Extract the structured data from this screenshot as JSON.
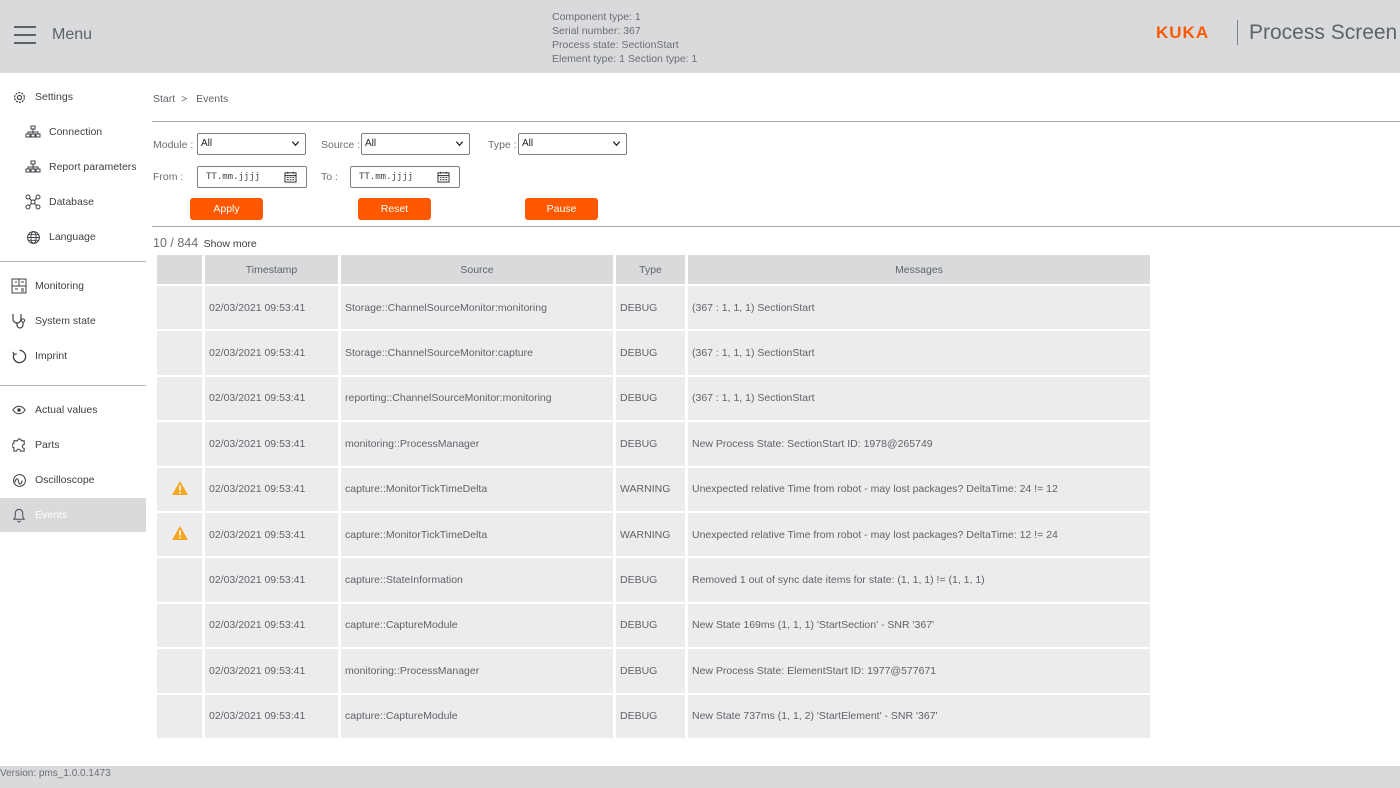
{
  "header": {
    "menu_label": "Menu",
    "info": {
      "component_type": "Component type: 1",
      "serial_number": "Serial number: 367",
      "process_state": "Process state: SectionStart",
      "element_type": "Element type: 1 Section type: 1"
    },
    "brand": "KUKA",
    "app_title": "Process Screen",
    "brand_color": "#ff5800"
  },
  "sidebar": {
    "settings": "Settings",
    "connection": "Connection",
    "report_parameters": "Report parameters",
    "database": "Database",
    "language": "Language",
    "monitoring": "Monitoring",
    "system_state": "System state",
    "imprint": "Imprint",
    "actual_values": "Actual values",
    "parts": "Parts",
    "oscilloscope": "Oscilloscope",
    "events": "Events",
    "active_item": "Events"
  },
  "breadcrumb": {
    "root": "Start",
    "separator": ">",
    "current": "Events"
  },
  "filters": {
    "module_label": "Module :",
    "module_value": "All",
    "source_label": "Source :",
    "source_value": "All",
    "type_label": "Type :",
    "type_value": "All",
    "from_label": "From :",
    "from_placeholder": "TT.mm.jjjj",
    "to_label": "To :",
    "to_placeholder": "TT.mm.jjjj"
  },
  "buttons": {
    "apply": "Apply",
    "reset": "Reset",
    "pause": "Pause"
  },
  "results": {
    "count": "10 / 844",
    "show_more": "Show more"
  },
  "table": {
    "columns": [
      "",
      "Timestamp",
      "Source",
      "Type",
      "Messages"
    ],
    "rows": [
      {
        "icon": "",
        "timestamp": "02/03/2021 09:53:41",
        "source": "Storage::ChannelSourceMonitor:monitoring",
        "type": "DEBUG",
        "message": "(367 : 1, 1, 1) SectionStart"
      },
      {
        "icon": "",
        "timestamp": "02/03/2021 09:53:41",
        "source": "Storage::ChannelSourceMonitor:capture",
        "type": "DEBUG",
        "message": "(367 : 1, 1, 1) SectionStart"
      },
      {
        "icon": "",
        "timestamp": "02/03/2021 09:53:41",
        "source": "reporting::ChannelSourceMonitor:monitoring",
        "type": "DEBUG",
        "message": "(367 : 1, 1, 1) SectionStart"
      },
      {
        "icon": "",
        "timestamp": "02/03/2021 09:53:41",
        "source": "monitoring::ProcessManager",
        "type": "DEBUG",
        "message": "New Process State: SectionStart ID: 1978@265749"
      },
      {
        "icon": "warning-icon",
        "timestamp": "02/03/2021 09:53:41",
        "source": "capture::MonitorTickTimeDelta",
        "type": "WARNING",
        "message": "Unexpected relative Time from robot - may lost packages? DeltaTime: 24 != 12"
      },
      {
        "icon": "warning-icon",
        "timestamp": "02/03/2021 09:53:41",
        "source": "capture::MonitorTickTimeDelta",
        "type": "WARNING",
        "message": "Unexpected relative Time from robot - may lost packages? DeltaTime: 12 != 24"
      },
      {
        "icon": "",
        "timestamp": "02/03/2021 09:53:41",
        "source": "capture::StateInformation",
        "type": "DEBUG",
        "message": "Removed 1 out of sync date items for state: (1, 1, 1) != (1, 1, 1)"
      },
      {
        "icon": "",
        "timestamp": "02/03/2021 09:53:41",
        "source": "capture::CaptureModule",
        "type": "DEBUG",
        "message": "New State 169ms (1, 1, 1) 'StartSection' - SNR '367'"
      },
      {
        "icon": "",
        "timestamp": "02/03/2021 09:53:41",
        "source": "monitoring::ProcessManager",
        "type": "DEBUG",
        "message": "New Process State: ElementStart ID: 1977@577671"
      },
      {
        "icon": "",
        "timestamp": "02/03/2021 09:53:41",
        "source": "capture::CaptureModule",
        "type": "DEBUG",
        "message": "New State 737ms (1, 1, 2) 'StartElement' - SNR '367'"
      }
    ],
    "warning_color": "#f5a623"
  },
  "footer": {
    "version": "Version: pms_1.0.0.1473"
  }
}
